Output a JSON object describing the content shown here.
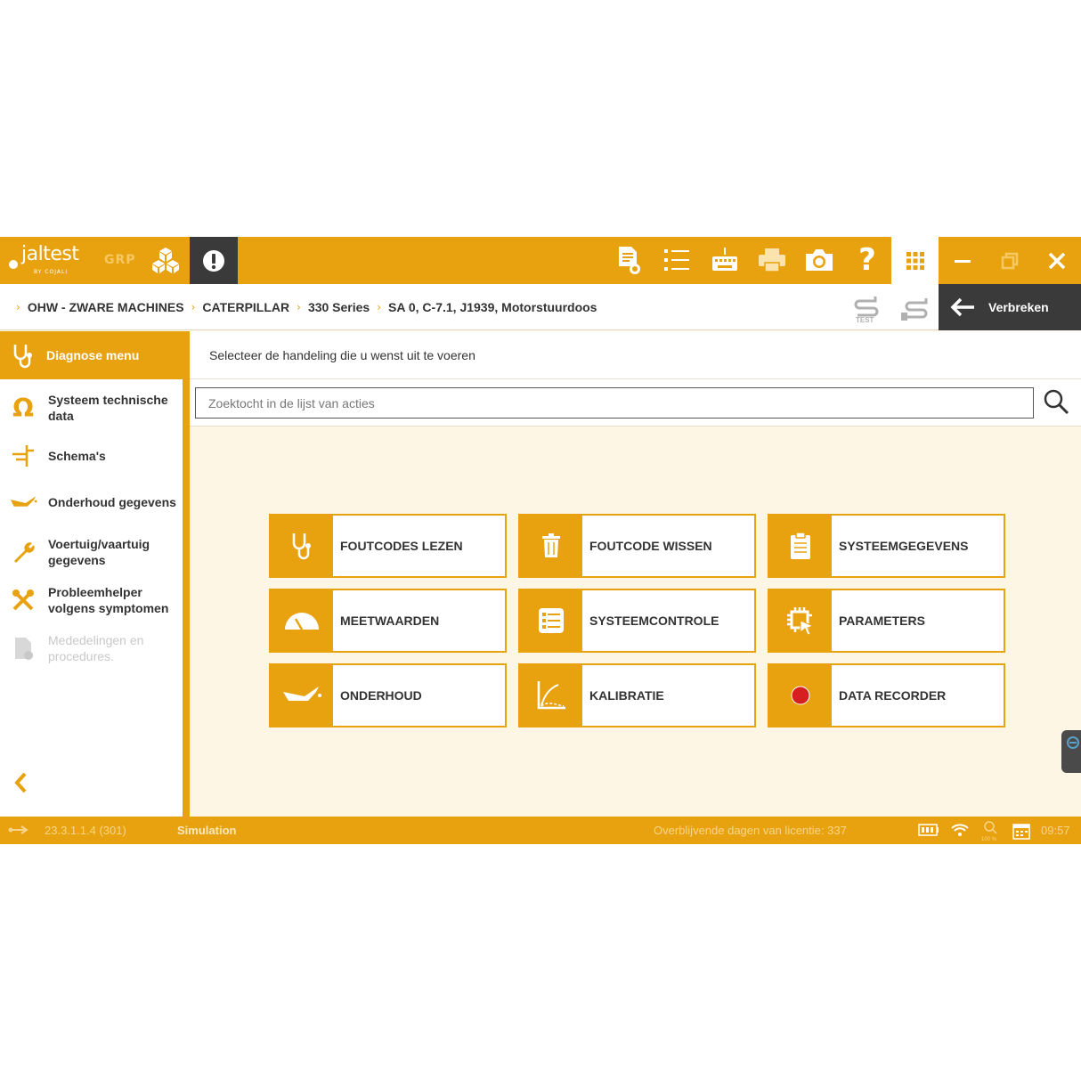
{
  "toolbar": {
    "logo_text": "jaltest",
    "logo_sub": "BY COJALI",
    "mode_label": "GRP",
    "icons": [
      "cubes-icon",
      "alert-icon",
      "report-icon",
      "list-icon",
      "keyboard-icon",
      "printer-icon",
      "camera-icon",
      "help-icon",
      "apps-grid-icon",
      "minimize-icon",
      "restore-icon",
      "close-icon"
    ]
  },
  "breadcrumb": {
    "items": [
      "OHW - ZWARE MACHINES",
      "CATERPILLAR",
      "330 Series",
      "SA 0, C-7.1, J1939, Motorstuurdoos"
    ],
    "disconnect_label": "Verbreken",
    "test_label": "TEST"
  },
  "sidebar": {
    "header_label": "Diagnose menu",
    "items": [
      {
        "label": "Systeem technische data",
        "icon": "omega-icon",
        "enabled": true
      },
      {
        "label": "Schema's",
        "icon": "schema-icon",
        "enabled": true
      },
      {
        "label": "Onderhoud gegevens",
        "icon": "oil-can-icon",
        "enabled": true
      },
      {
        "label": "Voertuig/vaartuig gegevens",
        "icon": "wrench-icon",
        "enabled": true
      },
      {
        "label": "Probleemhelper volgens symptomen",
        "icon": "tools-icon",
        "enabled": true
      },
      {
        "label": "Mededelingen en procedures.",
        "icon": "document-icon",
        "enabled": false
      }
    ]
  },
  "main": {
    "instruction": "Selecteer de handeling die u wenst uit te voeren",
    "search_placeholder": "Zoektocht in de lijst van acties",
    "actions": [
      {
        "label": "FOUTCODES LEZEN",
        "icon": "stethoscope-icon"
      },
      {
        "label": "FOUTCODE WISSEN",
        "icon": "trash-icon"
      },
      {
        "label": "SYSTEEMGEGEVENS",
        "icon": "clipboard-icon"
      },
      {
        "label": "MEETWAARDEN",
        "icon": "gauge-icon"
      },
      {
        "label": "SYSTEEMCONTROLE",
        "icon": "checklist-icon"
      },
      {
        "label": "PARAMETERS",
        "icon": "chip-cursor-icon"
      },
      {
        "label": "ONDERHOUD",
        "icon": "oil-can-icon"
      },
      {
        "label": "KALIBRATIE",
        "icon": "calibration-curve-icon"
      },
      {
        "label": "DATA RECORDER",
        "icon": "record-dot-icon"
      }
    ]
  },
  "status": {
    "version": "23.3.1.1.4 (301)",
    "mode": "Simulation",
    "license": "Overblijvende dagen van licentie: 337",
    "zoom": "100 %",
    "time": "09:57"
  },
  "colors": {
    "accent": "#e8a20f",
    "dark": "#3a3a3a",
    "record": "#d62020"
  }
}
